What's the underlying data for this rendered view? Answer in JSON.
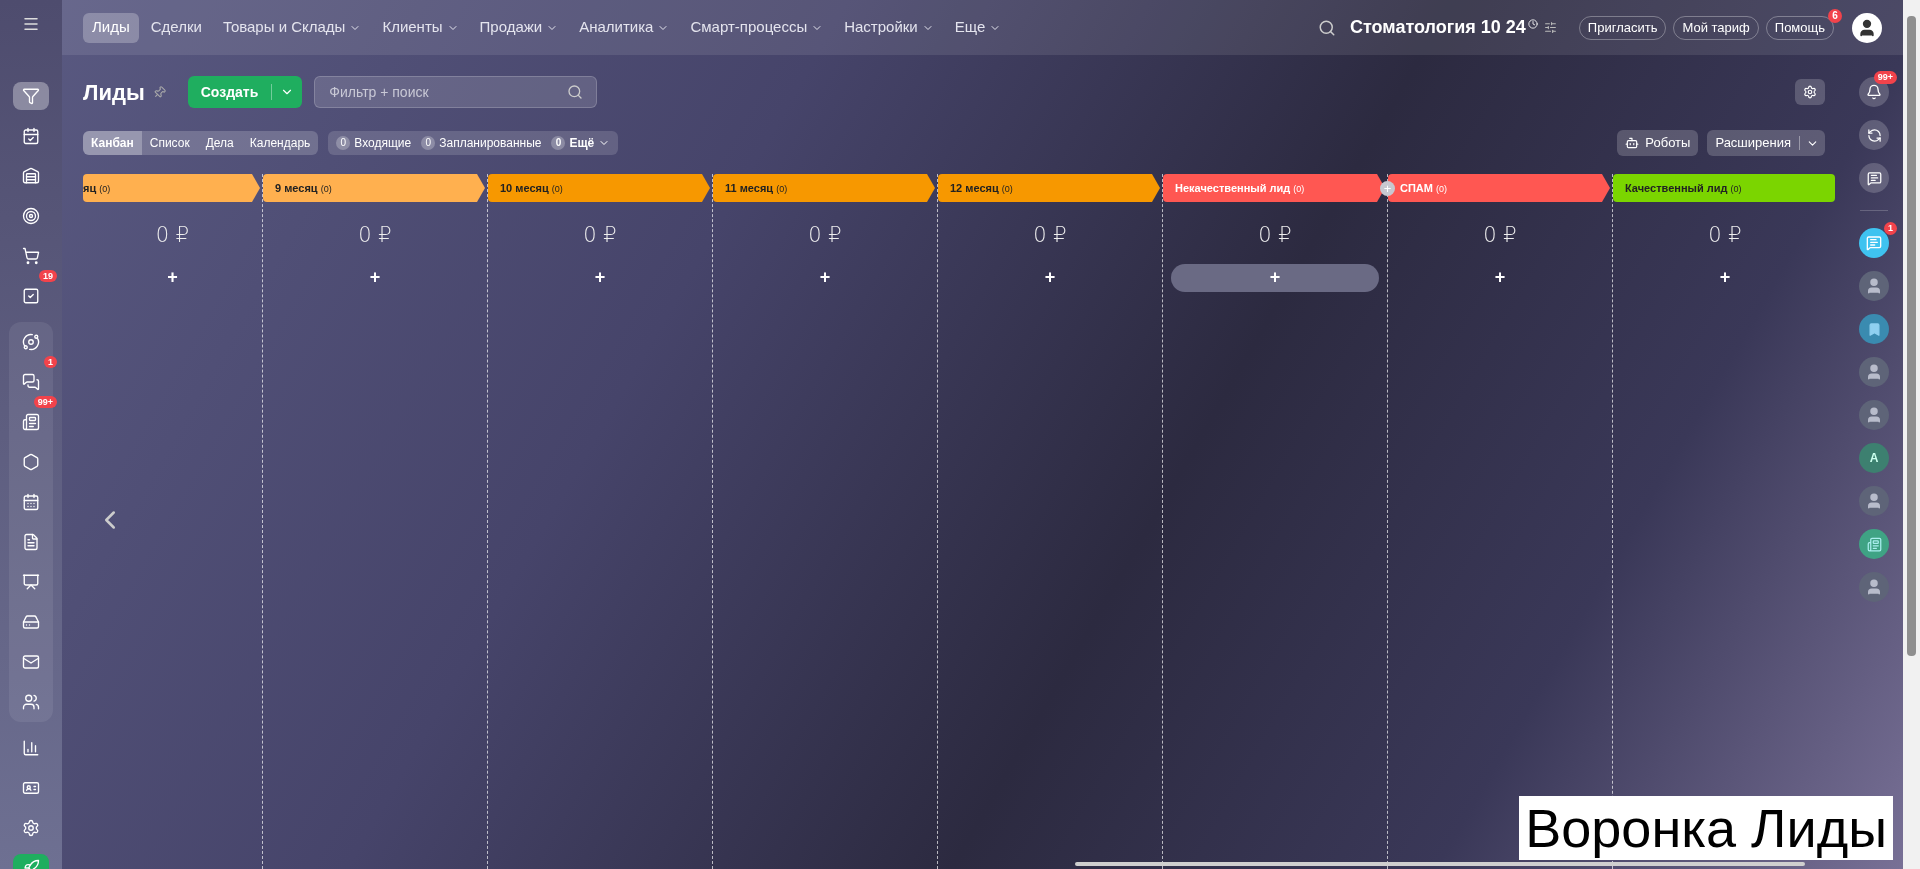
{
  "top_nav": {
    "items": [
      {
        "label": "Лиды",
        "selected": true,
        "dropdown": false
      },
      {
        "label": "Сделки",
        "selected": false,
        "dropdown": false
      },
      {
        "label": "Товары и Склады",
        "selected": false,
        "dropdown": true
      },
      {
        "label": "Клиенты",
        "selected": false,
        "dropdown": true
      },
      {
        "label": "Продажи",
        "selected": false,
        "dropdown": true
      },
      {
        "label": "Аналитика",
        "selected": false,
        "dropdown": true
      },
      {
        "label": "Смарт-процессы",
        "selected": false,
        "dropdown": true
      },
      {
        "label": "Настройки",
        "selected": false,
        "dropdown": true
      },
      {
        "label": "Еще",
        "selected": false,
        "dropdown": true
      }
    ],
    "portal_title": "Стоматология 10 24",
    "buttons": [
      {
        "label": "Пригласить"
      },
      {
        "label": "Мой тариф"
      },
      {
        "label": "Помощь",
        "badge": "6"
      }
    ]
  },
  "left_sidebar": {
    "top": [
      {
        "selected": true
      },
      {
        "selected": false
      },
      {
        "selected": false
      },
      {
        "selected": false
      },
      {
        "selected": false
      },
      {
        "selected": false,
        "badge": "19"
      }
    ],
    "group": [
      {
        "selected": false
      },
      {
        "selected": false,
        "badge": "1"
      },
      {
        "selected": false,
        "badge": "99+"
      },
      {
        "selected": false
      },
      {
        "selected": false
      },
      {
        "selected": false
      },
      {
        "selected": false
      },
      {
        "selected": false
      },
      {
        "selected": false
      },
      {
        "selected": false
      }
    ],
    "bottom": [
      {
        "selected": false
      },
      {
        "selected": false
      },
      {
        "selected": false
      },
      {
        "selected": false
      }
    ]
  },
  "page": {
    "title": "Лиды",
    "create_button": "Создать",
    "filter": {
      "placeholder": "Фильтр + поиск"
    },
    "views": [
      {
        "label": "Канбан",
        "selected": true
      },
      {
        "label": "Список",
        "selected": false
      },
      {
        "label": "Дела",
        "selected": false
      },
      {
        "label": "Календарь",
        "selected": false
      }
    ],
    "counters": [
      {
        "count": "0",
        "label": "Входящие"
      },
      {
        "count": "0",
        "label": "Запланированные"
      },
      {
        "count": "0",
        "label": "Ещё"
      }
    ],
    "robots_button": "Роботы",
    "extensions_button": "Расширения"
  },
  "columns": [
    {
      "title": "яц",
      "count": "(0)",
      "color": "#ffb04f",
      "sum": "0 ₽",
      "add": "+",
      "arrow": true,
      "hover": false
    },
    {
      "title": "9 месяц",
      "count": "(0)",
      "color": "#ffb04f",
      "sum": "0 ₽",
      "add": "+",
      "arrow": true,
      "hover": false
    },
    {
      "title": "10 месяц",
      "count": "(0)",
      "color": "#f79800",
      "sum": "0 ₽",
      "add": "+",
      "arrow": true,
      "hover": false
    },
    {
      "title": "11 месяц",
      "count": "(0)",
      "color": "#f79800",
      "sum": "0 ₽",
      "add": "+",
      "arrow": true,
      "hover": false
    },
    {
      "title": "12 месяц",
      "count": "(0)",
      "color": "#f79800",
      "sum": "0 ₽",
      "add": "+",
      "arrow": true,
      "hover": false
    },
    {
      "title": "Некачественный лид",
      "count": "(0)",
      "color": "#ff5752",
      "sum": "0 ₽",
      "add": "+",
      "arrow": true,
      "hover": true
    },
    {
      "title": "СПАМ",
      "count": "(0)",
      "color": "#ff5752",
      "sum": "0 ₽",
      "add": "+",
      "arrow": true,
      "hover": false
    },
    {
      "title": "Качественный лид",
      "count": "(0)",
      "color": "#7bd500",
      "sum": "0 ₽",
      "add": "+",
      "arrow": false,
      "hover": false
    }
  ],
  "right_sidebar": [
    {
      "kind": "bell",
      "badge": "99+"
    },
    {
      "kind": "spiral"
    },
    {
      "kind": "swap"
    },
    {
      "kind": "divider"
    },
    {
      "kind": "chat",
      "badge": "1"
    },
    {
      "kind": "avatar"
    },
    {
      "kind": "bookmark"
    },
    {
      "kind": "avatar"
    },
    {
      "kind": "avatar"
    },
    {
      "kind": "letter",
      "letter": "A"
    },
    {
      "kind": "avatar"
    },
    {
      "kind": "news"
    },
    {
      "kind": "avatar"
    }
  ],
  "caption": "Воронка Лиды"
}
